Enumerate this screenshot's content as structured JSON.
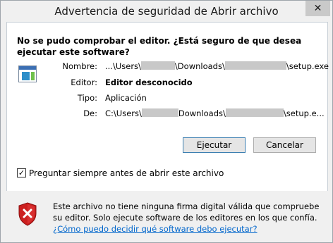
{
  "window": {
    "title": "Advertencia de seguridad de Abrir archivo",
    "close_glyph": "✕"
  },
  "question": "No se pudo comprobar el editor. ¿Está seguro de que desea ejecutar este software?",
  "details": {
    "name_label": "Nombre:",
    "name_value_1": "...\\Users\\",
    "name_value_2": "\\Downloads\\",
    "name_value_3": "\\setup.exe",
    "publisher_label": "Editor:",
    "publisher_value": "Editor desconocido",
    "type_label": "Tipo:",
    "type_value": "Aplicación",
    "from_label": "De:",
    "from_value_1": "C:\\Users\\",
    "from_value_2": "Downloads\\",
    "from_value_3": "\\setup.e..."
  },
  "buttons": {
    "run": "Ejecutar",
    "cancel": "Cancelar"
  },
  "checkbox": {
    "label": "Preguntar siempre antes de abrir este archivo",
    "checked": true,
    "mark": "✓"
  },
  "warning": {
    "text": "Este archivo no tiene ninguna firma digital válida que compruebe su editor. Solo ejecute software de los editores en los que confía. ",
    "link": "¿Cómo puedo decidir qué software debo ejecutar?"
  },
  "icons": {
    "app": "application-icon",
    "shield": "security-shield-warning-icon"
  },
  "colors": {
    "link": "#0066cc",
    "shield_red": "#cc1f1f"
  }
}
